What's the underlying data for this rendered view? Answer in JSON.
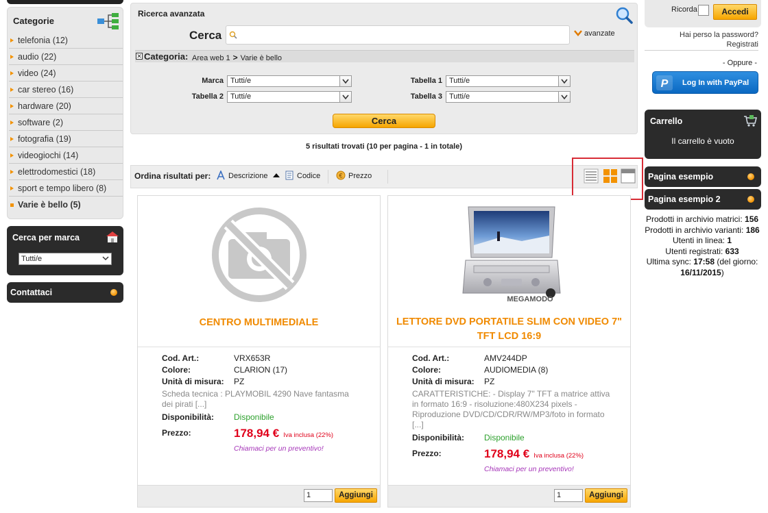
{
  "sidebar": {
    "categories_title": "Categorie",
    "categories": [
      {
        "label": "telefonia (12)"
      },
      {
        "label": "audio (22)"
      },
      {
        "label": "video (24)"
      },
      {
        "label": "car stereo (16)"
      },
      {
        "label": "hardware (20)"
      },
      {
        "label": "software (2)"
      },
      {
        "label": "fotografia (19)"
      },
      {
        "label": "videogiochi (14)"
      },
      {
        "label": "elettrodomestici (18)"
      },
      {
        "label": "sport e tempo libero (8)"
      },
      {
        "label": "Varie è bello (5)",
        "active": true
      }
    ],
    "brand_title": "Cerca per marca",
    "brand_select": "Tutti/e",
    "contact_title": "Contattaci"
  },
  "search": {
    "title": "Ricerca avanzata",
    "cerca_label": "Cerca",
    "input_value": "",
    "avanzate": "avanzate",
    "category_label": "Categoria:",
    "category_root": "Area web 1",
    "category_sep": ">",
    "category_leaf": "Varie è bello",
    "filters": {
      "marca_label": "Marca",
      "marca_value": "Tutti/e",
      "tabella1_label": "Tabella 1",
      "tabella1_value": "Tutti/e",
      "tabella2_label": "Tabella 2",
      "tabella2_value": "Tutti/e",
      "tabella3_label": "Tabella 3",
      "tabella3_value": "Tutti/e"
    },
    "button": "Cerca"
  },
  "results": {
    "count_text": "5 risultati trovati (10 per pagina - 1 in totale)",
    "sort_label": "Ordina risultati per:",
    "sort_options": [
      "Descrizione",
      "Codice",
      "Prezzo"
    ]
  },
  "products": [
    {
      "title_line1": "CENTRO MULTIMEDIALE",
      "title_line2": "",
      "cod_label": "Cod. Art.:",
      "cod": "VRX653R",
      "color_label": "Colore:",
      "color": "CLARION (17)",
      "unit_label": "Unità di misura:",
      "unit": "PZ",
      "description": "Scheda tecnica : PLAYMOBIL 4290 Nave fantasma dei pirati [...]",
      "avail_label": "Disponibilità:",
      "avail": "Disponibile",
      "price_label": "Prezzo:",
      "price": "178,94 €",
      "vat": "Iva inclusa (22%)",
      "callus": "Chiamaci per un preventivo!",
      "qty": "1",
      "add": "Aggiungi"
    },
    {
      "title_line1": "LETTORE DVD PORTATILE SLIM CON VIDEO 7\"",
      "title_line2": "TFT LCD 16:9",
      "image_caption": "MEGAMODO",
      "cod_label": "Cod. Art.:",
      "cod": "AMV244DP",
      "color_label": "Colore:",
      "color": "AUDIOMEDIA (8)",
      "unit_label": "Unità di misura:",
      "unit": "PZ",
      "description": "CARATTERISTICHE: - Display 7\" TFT a matrice attiva in formato 16:9 - risoluzione:480X234 pixels - Riproduzione DVD/CD/CDR/RW/MP3/foto in formato [...]",
      "avail_label": "Disponibilità:",
      "avail": "Disponibile",
      "price_label": "Prezzo:",
      "price": "178,94 €",
      "vat": "Iva inclusa (22%)",
      "callus": "Chiamaci per un preventivo!",
      "qty": "1",
      "add": "Aggiungi"
    }
  ],
  "login": {
    "ricorda": "Ricorda",
    "accedi": "Accedi",
    "forgot": "Hai perso la password?",
    "register": "Registrati",
    "oppure": "- Oppure -",
    "paypal": "Log In with PayPal"
  },
  "cart": {
    "title": "Carrello",
    "empty": "Il carrello è vuoto"
  },
  "pages": [
    "Pagina esempio",
    "Pagina esempio 2"
  ],
  "stats": {
    "l1": "Prodotti in archivio matrici:",
    "v1": "156",
    "l2": "Prodotti in archivio varianti:",
    "v2": "186",
    "l3": "Utenti in linea:",
    "v3": "1",
    "l4": "Utenti registrati:",
    "v4": "633",
    "l5": "Ultima sync:",
    "v5": "17:58",
    "l6": "(del giorno:",
    "v6": "16/11/2015",
    "l7": ")"
  },
  "colors": {
    "accent": "#f39200",
    "price": "#e0001a",
    "available": "#2ca02c",
    "dark_box": "#2b2b2b",
    "highlight": "#d72b35"
  }
}
